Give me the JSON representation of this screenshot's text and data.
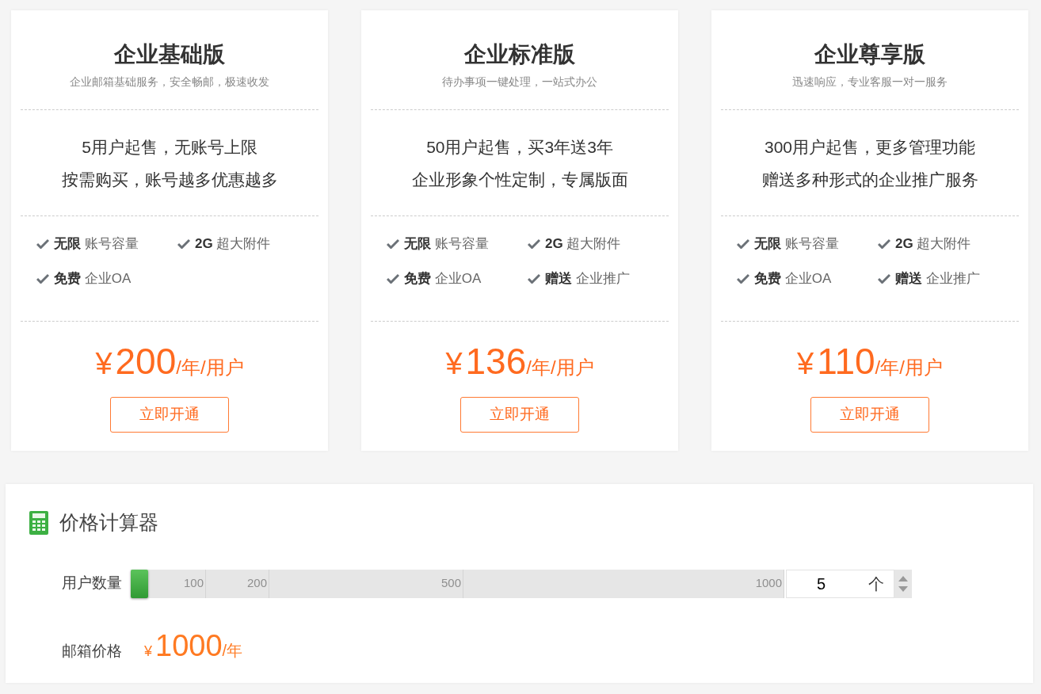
{
  "plans": [
    {
      "title": "企业基础版",
      "subtitle": "企业邮箱基础服务，安全畅邮，极速收发",
      "highlights": [
        "5用户起售，无账号上限",
        "按需购买，账号越多优惠越多"
      ],
      "features": [
        {
          "strong": "无限",
          "text": "账号容量"
        },
        {
          "strong": "2G",
          "text": "超大附件"
        },
        {
          "strong": "免费",
          "text": "企业OA"
        }
      ],
      "price": {
        "currency": "¥",
        "amount": "200",
        "unit": "/年/用户"
      },
      "button": "立即开通"
    },
    {
      "title": "企业标准版",
      "subtitle": "待办事项一键处理，一站式办公",
      "highlights": [
        "50用户起售，买3年送3年",
        "企业形象个性定制，专属版面"
      ],
      "features": [
        {
          "strong": "无限",
          "text": "账号容量"
        },
        {
          "strong": "2G",
          "text": "超大附件"
        },
        {
          "strong": "免费",
          "text": "企业OA"
        },
        {
          "strong": "赠送",
          "text": "企业推广"
        }
      ],
      "price": {
        "currency": "¥",
        "amount": "136",
        "unit": "/年/用户"
      },
      "button": "立即开通"
    },
    {
      "title": "企业尊享版",
      "subtitle": "迅速响应，专业客服一对一服务",
      "highlights": [
        "300用户起售，更多管理功能",
        "赠送多种形式的企业推广服务"
      ],
      "features": [
        {
          "strong": "无限",
          "text": "账号容量"
        },
        {
          "strong": "2G",
          "text": "超大附件"
        },
        {
          "strong": "免费",
          "text": "企业OA"
        },
        {
          "strong": "赠送",
          "text": "企业推广"
        }
      ],
      "price": {
        "currency": "¥",
        "amount": "110",
        "unit": "/年/用户"
      },
      "button": "立即开通"
    }
  ],
  "calculator": {
    "title": "价格计算器",
    "users_label": "用户数量",
    "slider": {
      "level": 0,
      "ticks": [
        "100",
        "200",
        "500",
        "1000"
      ]
    },
    "count": {
      "value": "5",
      "unit": "个"
    },
    "price_label": "邮箱价格",
    "total": {
      "currency": "¥",
      "amount": "1000",
      "unit": "/年"
    }
  }
}
